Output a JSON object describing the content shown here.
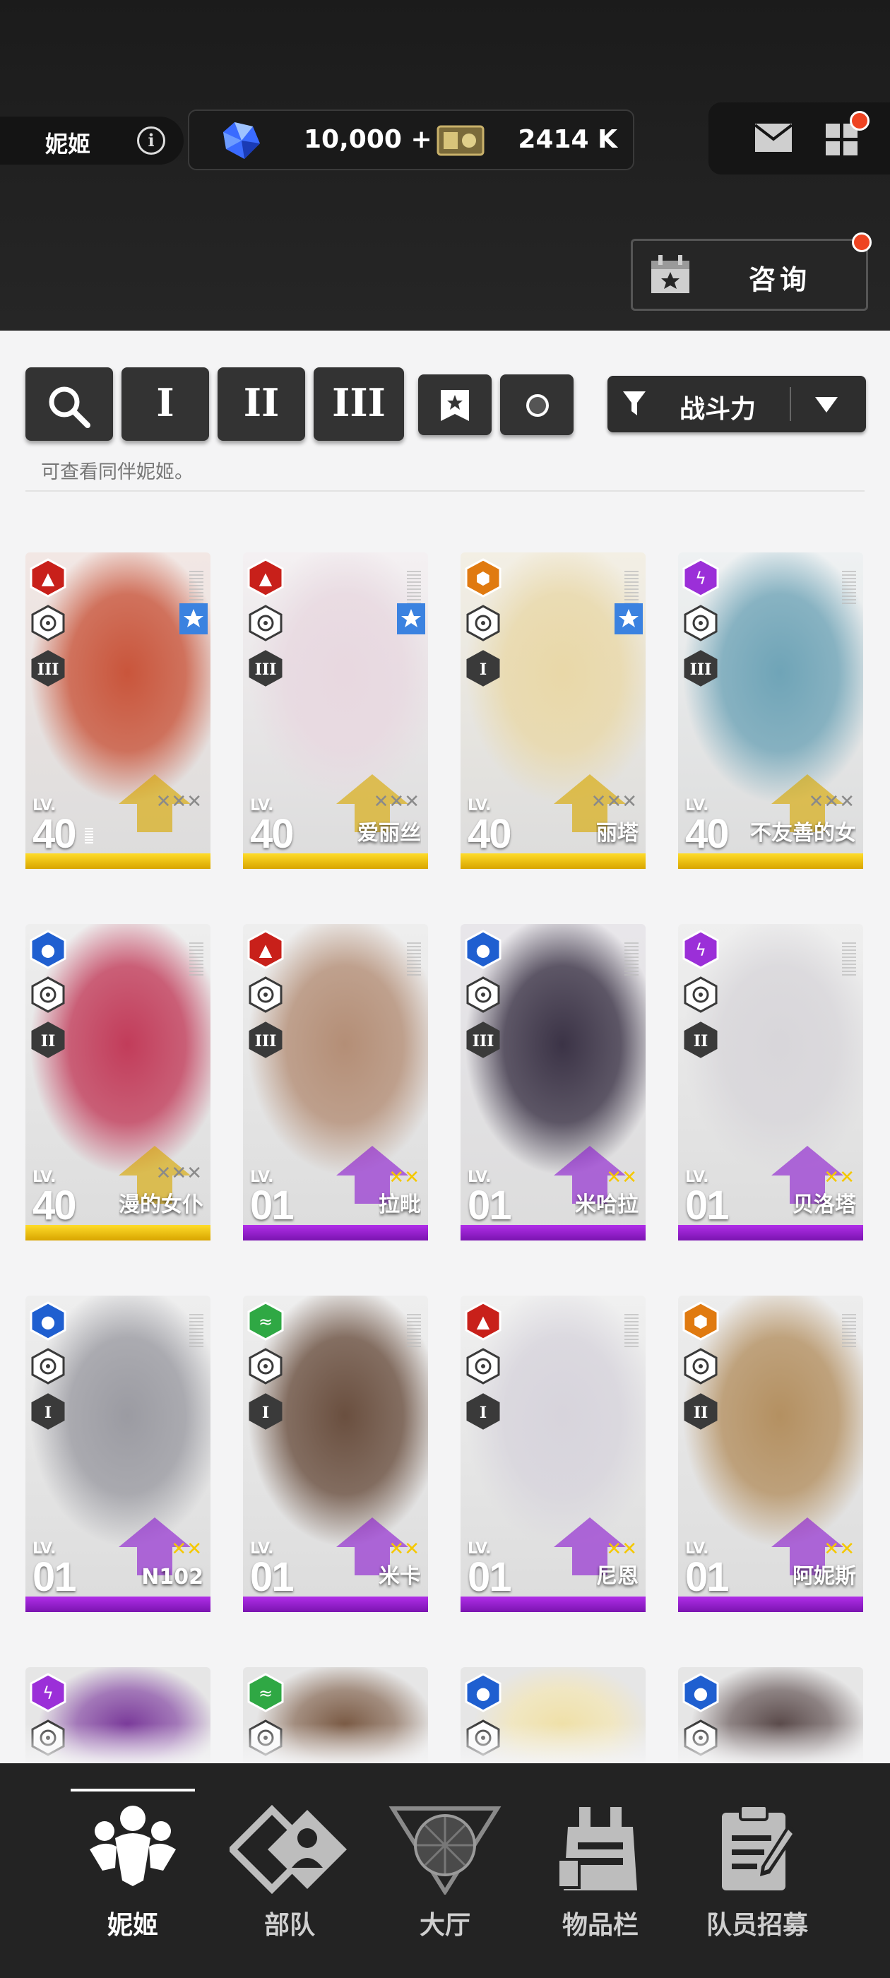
{
  "header": {
    "user_name": "妮姬",
    "info_icon": "i",
    "gems": "10,000 +",
    "credits": "2414 K",
    "consult_label": "咨询"
  },
  "filters": {
    "search_icon": "search-icon",
    "burst_1": "I",
    "burst_2": "II",
    "burst_3": "III",
    "sort_label": "战斗力",
    "hint": "可查看同伴妮姬。"
  },
  "cards": [
    {
      "level": "40",
      "name": "",
      "element": "fire",
      "burst": "III",
      "rarity": "gold",
      "favorite": true
    },
    {
      "level": "40",
      "name": "爱丽丝",
      "element": "fire",
      "burst": "III",
      "rarity": "gold",
      "favorite": true
    },
    {
      "level": "40",
      "name": "丽塔",
      "element": "iron",
      "burst": "I",
      "rarity": "gold",
      "favorite": true
    },
    {
      "level": "40",
      "name": "不友善的女",
      "element": "electric",
      "burst": "III",
      "rarity": "gold",
      "favorite": false
    },
    {
      "level": "40",
      "name": "漫的女仆",
      "element": "water",
      "burst": "II",
      "rarity": "gold",
      "favorite": false
    },
    {
      "level": "01",
      "name": "拉毗",
      "element": "fire",
      "burst": "III",
      "rarity": "purple",
      "favorite": false
    },
    {
      "level": "01",
      "name": "米哈拉",
      "element": "water",
      "burst": "III",
      "rarity": "purple",
      "favorite": false
    },
    {
      "level": "01",
      "name": "贝洛塔",
      "element": "electric",
      "burst": "II",
      "rarity": "purple",
      "favorite": false
    },
    {
      "level": "01",
      "name": "N102",
      "element": "water",
      "burst": "I",
      "rarity": "purple",
      "favorite": false
    },
    {
      "level": "01",
      "name": "米卡",
      "element": "wind",
      "burst": "I",
      "rarity": "purple",
      "favorite": false
    },
    {
      "level": "01",
      "name": "尼恩",
      "element": "fire",
      "burst": "I",
      "rarity": "purple",
      "favorite": false
    },
    {
      "level": "01",
      "name": "阿妮斯",
      "element": "iron",
      "burst": "II",
      "rarity": "purple",
      "favorite": false
    }
  ],
  "lv_label": "LV.",
  "colors": {
    "fire": "#c8201a",
    "water": "#1f5fd0",
    "electric": "#9b2fd8",
    "wind": "#2fa844",
    "iron": "#e07a10",
    "gold_bar": "#f2c200",
    "purple_bar": "#9a22d4"
  },
  "nav": {
    "tabs": [
      {
        "label": "妮姬",
        "icon": "nikke-group-icon",
        "active": true
      },
      {
        "label": "部队",
        "icon": "squad-icon",
        "active": false
      },
      {
        "label": "大厅",
        "icon": "lobby-icon",
        "active": false
      },
      {
        "label": "物品栏",
        "icon": "inventory-icon",
        "active": false
      },
      {
        "label": "队员招募",
        "icon": "recruit-icon",
        "active": false
      }
    ]
  }
}
